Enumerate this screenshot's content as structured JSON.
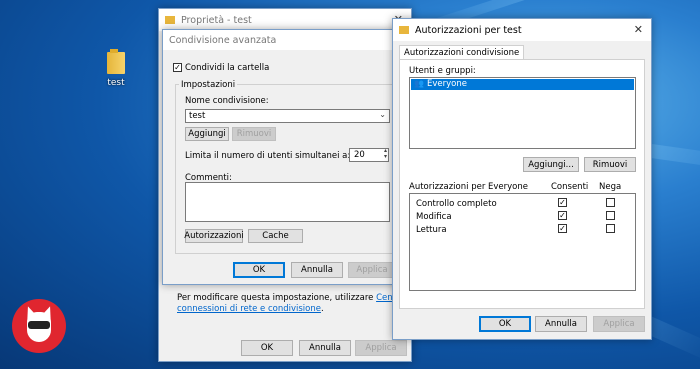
{
  "desktop": {
    "icon_label": "test"
  },
  "prop_window": {
    "title": "Proprietà - test",
    "info_text": "Per modificare questa impostazione, utilizzare",
    "info_link_a": "Centro",
    "info_link_b": "connessioni di rete e condivisione",
    "info_end": ".",
    "ok": "OK",
    "annulla": "Annulla",
    "applica": "Applica"
  },
  "advanced_sharing": {
    "title": "Condivisione avanzata",
    "share_checkbox_label": "Condividi la cartella",
    "share_checked": true,
    "settings_group": "Impostazioni",
    "share_name_label": "Nome condivisione:",
    "share_name_value": "test",
    "add_btn": "Aggiungi",
    "remove_btn": "Rimuovi",
    "limit_label": "Limita il numero di utenti simultanei a:",
    "limit_value": "20",
    "comments_label": "Commenti:",
    "comments_value": "",
    "permissions_btn": "Autorizzazioni",
    "cache_btn": "Cache",
    "ok": "OK",
    "annulla": "Annulla",
    "applica": "Applica"
  },
  "permissions_window": {
    "title": "Autorizzazioni per test",
    "tab": "Autorizzazioni condivisione",
    "users_label": "Utenti e gruppi:",
    "users": [
      "Everyone"
    ],
    "add_btn": "Aggiungi...",
    "remove_btn": "Rimuovi",
    "perm_header": "Autorizzazioni per Everyone",
    "col_allow": "Consenti",
    "col_deny": "Nega",
    "permissions": [
      {
        "name": "Controllo completo",
        "allow": true,
        "deny": false
      },
      {
        "name": "Modifica",
        "allow": true,
        "deny": false
      },
      {
        "name": "Lettura",
        "allow": true,
        "deny": false
      }
    ],
    "ok": "OK",
    "annulla": "Annulla",
    "applica": "Applica"
  },
  "colors": {
    "accent": "#0078d7",
    "selection": "#0078d7",
    "logo_red": "#e0262f"
  },
  "icons": {
    "folder": "folder-icon",
    "users": "users-group-icon",
    "close": "close-icon"
  }
}
